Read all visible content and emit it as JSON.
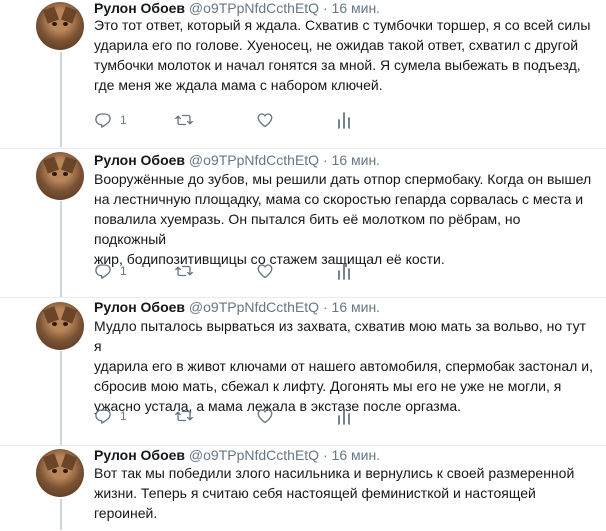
{
  "tweets": [
    {
      "name": "",
      "handle": "",
      "time": "",
      "text": "Это тот ответ, который я ждала. Схватив с тумбочки торшер, я со всей силы\nударила его по голове. Хуеносец, не ожидав такой ответ, схватил с другой\nтумбочки молоток и начал гонятся за мной. Я сумела выбежать в подъезд,\nгде меня же ждала мама с набором ключей.",
      "reply_count": "1"
    },
    {
      "name": "Рулон Обоев",
      "handle": "@o9TPpNfdCcthEtQ",
      "time": "16 мин.",
      "text": "Вооружённые до зубов, мы решили дать отпор спермобаку. Когда он вышел\nна лестничную площадку, мама со скоростью гепарда сорвалась с места и\nповалила хуемразь. Он пытался бить её молотком по рёбрам, но подкожный\nжир, бодипозитивщицы со стажем защищал её кости.",
      "reply_count": "1"
    },
    {
      "name": "Рулон Обоев",
      "handle": "@o9TPpNfdCcthEtQ",
      "time": "16 мин.",
      "text": "Мудло пыталось вырваться из захвата, схватив мою мать за вольво, но тут я\nударила его в живот ключами от нашего автомобиля, спермобак застонал и,\nсбросив мою мать, сбежал к лифту. Догонять мы его не уже не могли, я\nужасно устала, а мама лежала в экстазе после оргазма.",
      "reply_count": "1"
    },
    {
      "name": "Рулон Обоев",
      "handle": "@o9TPpNfdCcthEtQ",
      "time": "16 мин.",
      "text": "Вот так мы победили злого насильника и вернулись к своей размеренной\nжизни. Теперь я считаю себя настоящей феминисткой и настоящей\nгероиней.",
      "reply_count": ""
    }
  ],
  "first_header": {
    "name": "Рулон Обоев",
    "handle": "@o9TPpNfdCcthEtQ",
    "time": "16 мин."
  },
  "colors": {
    "secondary_text": "#657786",
    "thread_line": "#ccd6dd",
    "divider": "#e6ecf0"
  },
  "icons": [
    "reply-icon",
    "retweet-icon",
    "like-icon",
    "analytics-icon"
  ]
}
